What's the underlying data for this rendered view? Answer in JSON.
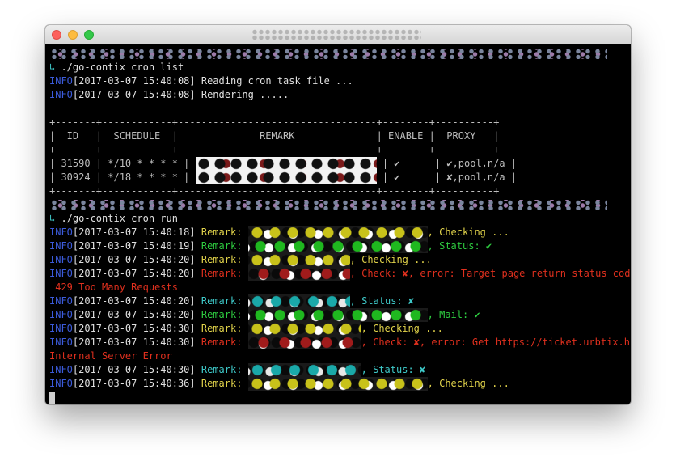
{
  "window": {
    "buttons": {
      "close": "close-icon",
      "minimize": "minimize-icon",
      "maximize": "maximize-icon"
    }
  },
  "colors": {
    "info": "#3b5bdb",
    "yellow": "#e0d24a",
    "green": "#2ecc40",
    "red": "#e0301e",
    "cyan": "#3ec9c9",
    "background": "#000000"
  },
  "terminal": {
    "prompt_glyph": "↳",
    "cmd1": " ./go-contix cron list",
    "info_tag": "INFO",
    "log1_ts": "[2017-03-07 15:40:08]",
    "log1_msg": " Reading cron task file ...",
    "log2_ts": "[2017-03-07 15:40:08]",
    "log2_msg": " Rendering .....",
    "table": {
      "border": "+-------+------------+----------------------------------+--------+----------+",
      "header": "|  ID   |  SCHEDULE  |              REMARK              | ENABLE |  PROXY   |",
      "row1_pre": "| 31590 | */10 * * * * | ",
      "row1_post": " | ✔      | ✔,pool,n/a |",
      "row2_pre": "| 30924 | */18 * * * * | ",
      "row2_post": " | ✔      | ✘,pool,n/a |"
    },
    "cmd2": " ./go-contix cron run",
    "run": [
      {
        "ts": "[2017-03-07 15:40:18]",
        "label": " Remark: ",
        "suffix": ", Checking ..."
      },
      {
        "ts": "[2017-03-07 15:40:19]",
        "label": " Remark: ",
        "suffix": ", Status: ✔"
      },
      {
        "ts": "[2017-03-07 15:40:20]",
        "label": " Remark: ",
        "suffix": ", Checking ..."
      },
      {
        "ts": "[2017-03-07 15:40:20]",
        "label": " Remark: ",
        "suffix": ", Check: ✘, error: Target page return status code:"
      },
      {
        "continuation": " 429 Too Many Requests"
      },
      {
        "ts": "[2017-03-07 15:40:20]",
        "label": " Remark: ",
        "suffix": ", Status: ✘"
      },
      {
        "ts": "[2017-03-07 15:40:20]",
        "label": " Remark: ",
        "suffix": ", Mail: ✔"
      },
      {
        "ts": "[2017-03-07 15:40:30]",
        "label": " Remark: ",
        "suffix": ", Checking ..."
      },
      {
        "ts": "[2017-03-07 15:40:30]",
        "label": " Remark: ",
        "suffix": ", Check: ✘, error: Get https://ticket.urbtix.hk/:"
      },
      {
        "continuation": "Internal Server Error"
      },
      {
        "ts": "[2017-03-07 15:40:30]",
        "label": " Remark: ",
        "suffix": ", Status: ✘"
      },
      {
        "ts": "[2017-03-07 15:40:36]",
        "label": " Remark: ",
        "suffix": ", Checking ..."
      }
    ]
  }
}
